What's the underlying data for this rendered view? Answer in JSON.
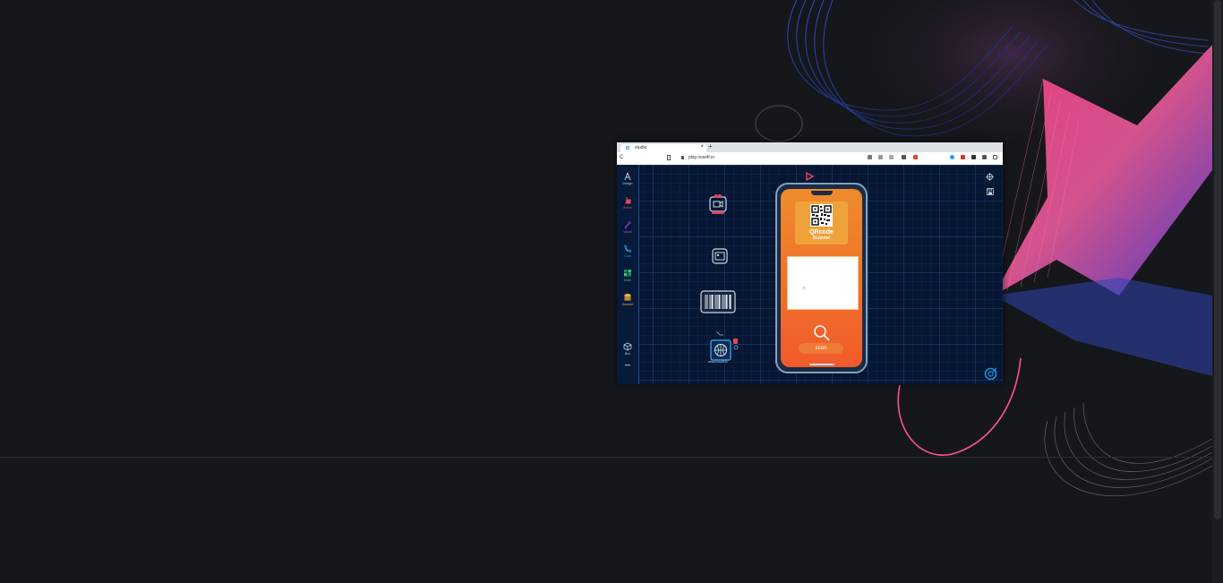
{
  "browser": {
    "tab_title": "studio",
    "tab_close": "×",
    "new_tab": "+",
    "reload": "C",
    "url": "play.nosoft.io"
  },
  "sidebar": {
    "items": [
      {
        "label": "Design",
        "icon": "compass-icon",
        "color": "#c5d0dc"
      },
      {
        "label": "Action",
        "icon": "hand-pointer-icon",
        "color": "#e0485a"
      },
      {
        "label": "Visuel",
        "icon": "magic-wand-icon",
        "color": "#c04ad8"
      },
      {
        "label": "Com",
        "icon": "phone-icon",
        "color": "#2aa7d8"
      },
      {
        "label": "Math",
        "icon": "plus-minus-icon",
        "color": "#38c47a"
      },
      {
        "label": "Donnée",
        "icon": "database-icon",
        "color": "#f0b23a"
      },
      {
        "label": "Box",
        "icon": "cube-icon",
        "color": "#c5d0dc"
      }
    ],
    "more": "•••"
  },
  "canvas": {
    "globe_caption": "www.nosoft.io"
  },
  "phone": {
    "title": "QRcode",
    "subtitle": "Scanner",
    "scan_label": "scan"
  },
  "colors": {
    "accent_orange": "#f15a2a",
    "canvas_bg": "#061633",
    "page_bg": "#16171b"
  }
}
